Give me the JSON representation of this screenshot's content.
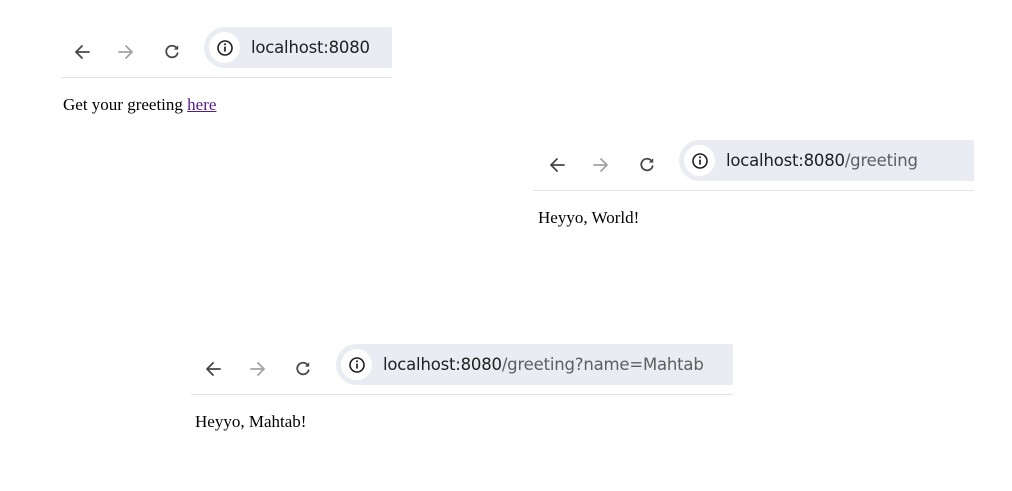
{
  "windows": [
    {
      "url_host": "localhost:8080",
      "url_path": "",
      "page": {
        "text": "Get your greeting ",
        "link_label": "here"
      }
    },
    {
      "url_host": "localhost:8080",
      "url_path": "/greeting",
      "page": {
        "text": "Heyyo, World!"
      }
    },
    {
      "url_host": "localhost:8080",
      "url_path": "/greeting?name=Mahtab",
      "page": {
        "text": "Heyyo, Mahtab!"
      }
    }
  ],
  "icons": {
    "back": "arrow-left-icon",
    "forward": "arrow-right-icon",
    "reload": "reload-icon",
    "site_info": "info-icon"
  },
  "colors": {
    "omnibox_bg": "#e9ecf3",
    "visited_link": "#551a8b",
    "disabled_icon": "#a3a3a3",
    "active_icon": "#474747"
  }
}
